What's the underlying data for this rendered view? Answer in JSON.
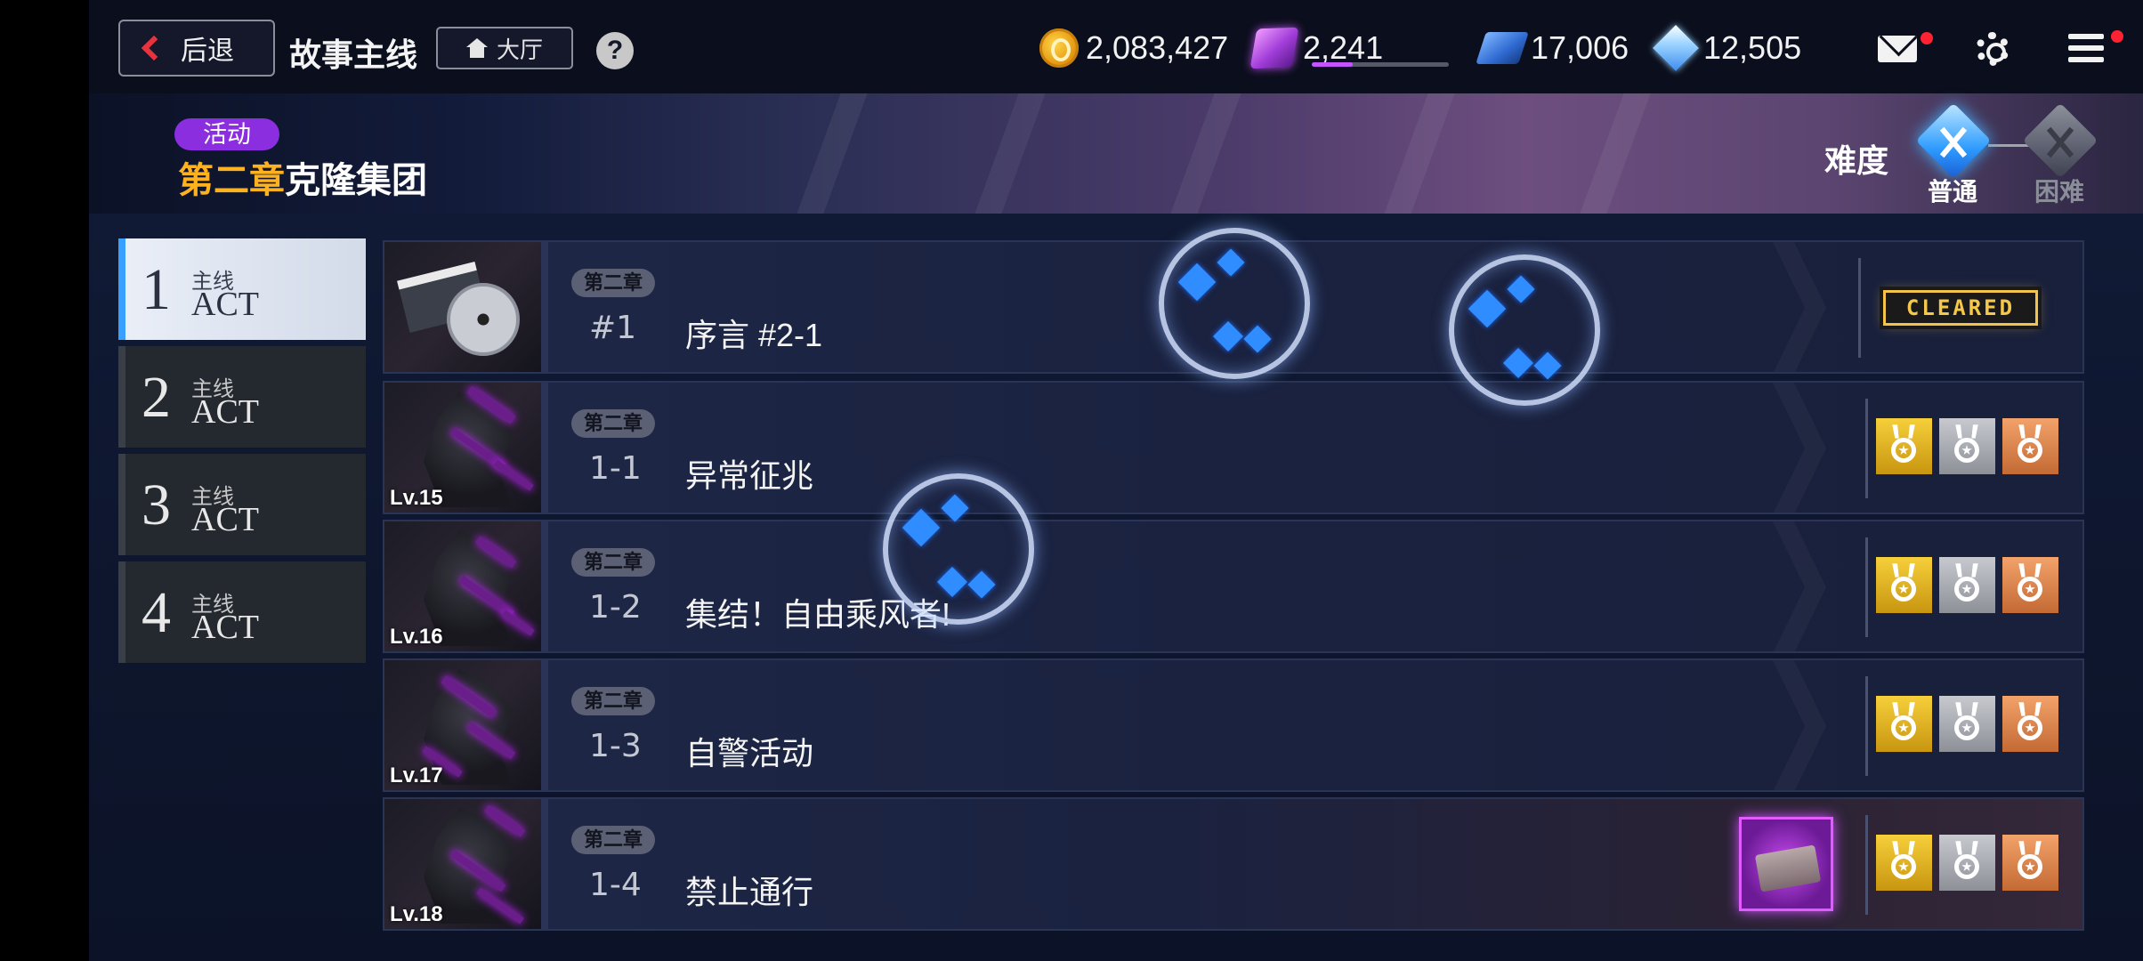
{
  "header": {
    "back_label": "后退",
    "title": "故事主线",
    "lobby_label": "大厅",
    "help_label": "?"
  },
  "resources": {
    "gold": "2,083,427",
    "stamina": "2,241",
    "stamina_fill": 0.3,
    "tickets": "17,006",
    "gems": "12,505"
  },
  "chapter": {
    "tag": "活动",
    "chapter_no": "第二章",
    "name": "克隆集团"
  },
  "difficulty": {
    "label": "难度",
    "normal": "普通",
    "hard": "困难",
    "selected": "normal"
  },
  "acts": [
    {
      "num": "1",
      "sub": "主线",
      "act": "ACT",
      "active": true
    },
    {
      "num": "2",
      "sub": "主线",
      "act": "ACT",
      "active": false
    },
    {
      "num": "3",
      "sub": "主线",
      "act": "ACT",
      "active": false
    },
    {
      "num": "4",
      "sub": "主线",
      "act": "ACT",
      "active": false
    }
  ],
  "stages": [
    {
      "chapter": "第二章",
      "num": "#1",
      "name": "序言  #2-1",
      "level": "",
      "status": "CLEARED"
    },
    {
      "chapter": "第二章",
      "num": "1-1",
      "name": "异常征兆",
      "level": "Lv.15",
      "medals": [
        "gold",
        "silver",
        "bronze"
      ]
    },
    {
      "chapter": "第二章",
      "num": "1-2",
      "name": "集结！自由乘风者!",
      "level": "Lv.16",
      "medals": [
        "gold",
        "silver",
        "bronze"
      ]
    },
    {
      "chapter": "第二章",
      "num": "1-3",
      "name": "自警活动",
      "level": "Lv.17",
      "medals": [
        "gold",
        "silver",
        "bronze"
      ]
    },
    {
      "chapter": "第二章",
      "num": "1-4",
      "name": "禁止通行",
      "level": "Lv.18",
      "medals": [
        "gold",
        "silver",
        "bronze"
      ],
      "reward": "cargo-item-icon"
    }
  ],
  "colors": {
    "accent": "#3aa0ff",
    "chapter_highlight": "#ffb21f",
    "event_tag": "#8a2ee0",
    "notification": "#ff2233",
    "cleared": "#f3c34c"
  }
}
